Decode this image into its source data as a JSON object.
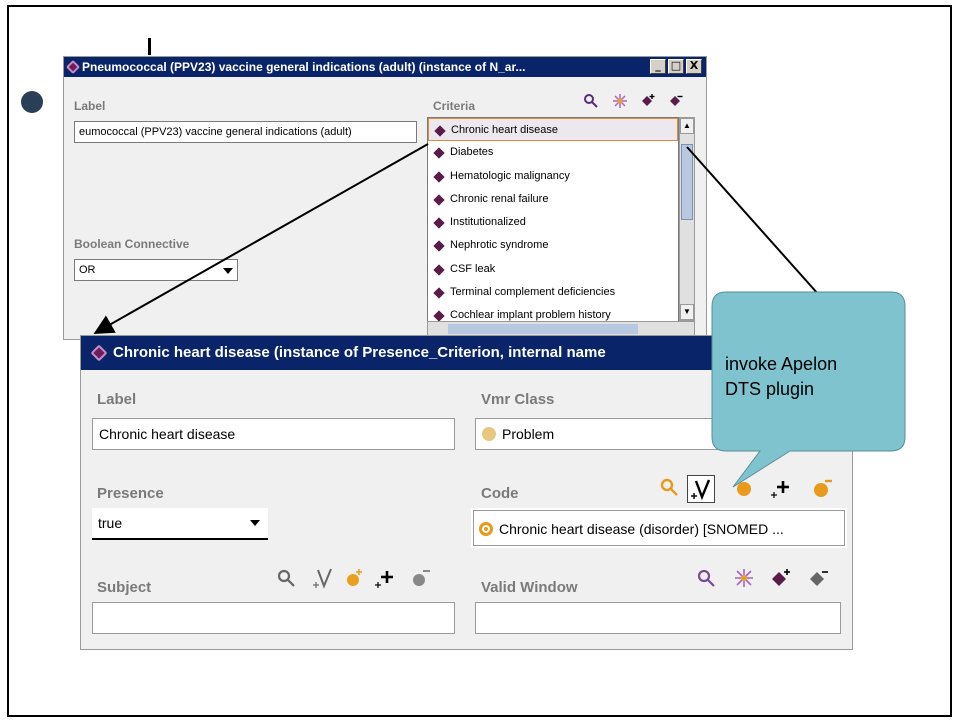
{
  "window1": {
    "title": "Pneumococcal (PPV23) vaccine general indications (adult)   (instance of N_ar...",
    "controls": [
      "_",
      "□",
      "X"
    ],
    "label_heading": "Label",
    "label_value": "eumococcal (PPV23) vaccine general indications (adult)",
    "boolean_heading": "Boolean Connective",
    "boolean_value": "OR",
    "criteria_heading": "Criteria",
    "criteria_items": [
      "Chronic heart disease",
      "Diabetes",
      "Hematologic malignancy",
      "Chronic renal failure",
      "Institutionalized",
      "Nephrotic syndrome",
      "CSF leak",
      "Terminal complement deficiencies",
      "Cochlear implant problem history"
    ],
    "criteria_tools": [
      "view-reference-icon",
      "create-instance-icon",
      "add-instance-icon",
      "remove-instance-icon"
    ]
  },
  "window2": {
    "title": "Chronic heart disease   (instance of Presence_Criterion, internal name",
    "label_heading": "Label",
    "label_value": "Chronic heart disease",
    "vmr_heading": "Vmr Class",
    "vmr_value": "Problem",
    "presence_heading": "Presence",
    "presence_value": "true",
    "code_heading": "Code",
    "code_value": "Chronic heart disease (disorder) [SNOMED ...",
    "subject_heading": "Subject",
    "valid_window_heading": "Valid Window"
  },
  "callout": {
    "line1": "invoke Apelon",
    "line2": "DTS plugin"
  },
  "colors": {
    "titlebar": "#0a246a",
    "callout_fill": "#7fc3cf",
    "diamond": "#5a1a4a",
    "vmr_dot": "#e8c880",
    "code_dot": "#e89a1c"
  }
}
